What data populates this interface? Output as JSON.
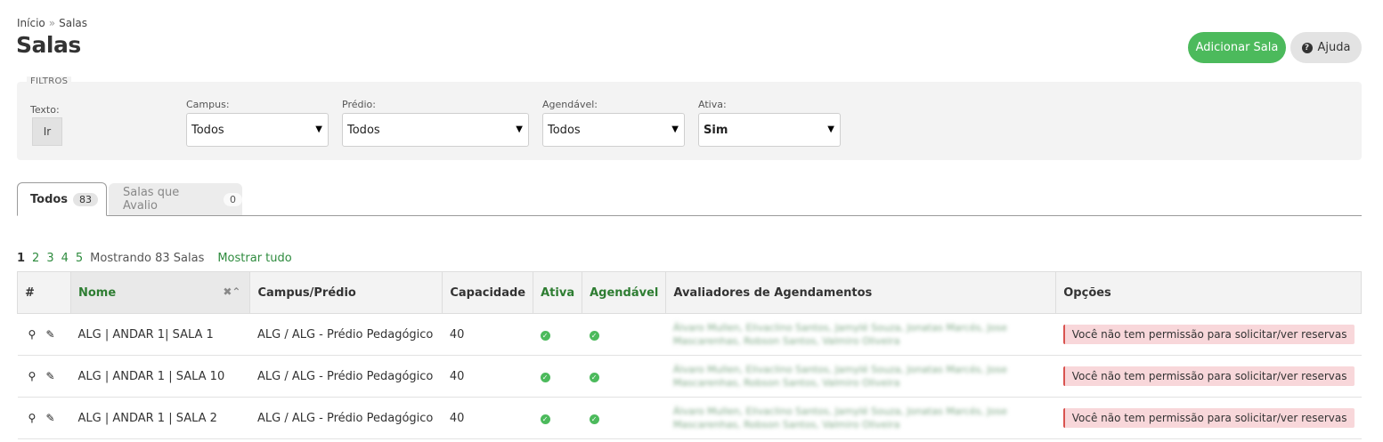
{
  "breadcrumb": {
    "home": "Início",
    "separator": "»",
    "current": "Salas"
  },
  "page_title": "Salas",
  "header_buttons": {
    "add": "Adicionar Sala",
    "help": "Ajuda"
  },
  "filters": {
    "legend": "FILTROS",
    "texto_label": "Texto:",
    "ir_label": "Ir",
    "campus_label": "Campus:",
    "campus_value": "Todos",
    "predio_label": "Prédio:",
    "predio_value": "Todos",
    "agendavel_label": "Agendável:",
    "agendavel_value": "Todos",
    "ativa_label": "Ativa:",
    "ativa_value": "Sim"
  },
  "tabs": [
    {
      "label": "Todos",
      "count": "83"
    },
    {
      "label": "Salas que Avalio",
      "count": "0"
    }
  ],
  "pagination": {
    "current": "1",
    "pages": [
      "2",
      "3",
      "4",
      "5"
    ],
    "info": "Mostrando 83 Salas",
    "show_all": "Mostrar tudo"
  },
  "table": {
    "headers": {
      "hash": "#",
      "nome": "Nome",
      "campus": "Campus/Prédio",
      "capacidade": "Capacidade",
      "ativa": "Ativa",
      "agendavel": "Agendável",
      "avaliadores": "Avaliadores de Agendamentos",
      "opcoes": "Opções"
    },
    "rows": [
      {
        "nome": "ALG | ANDAR 1| SALA 1",
        "campus": "ALG / ALG - Prédio Pedagógico",
        "capacidade": "40",
        "avaliadores": "Álvaro Mullen, Elivaclino Santos, Jamylé Souza, Jonatas Marcés, Jose Mascarenhas, Robson Santos, Valmiro Oliveira",
        "opcoes": "Você não tem permissão para solicitar/ver reservas"
      },
      {
        "nome": "ALG | ANDAR 1 | SALA 10",
        "campus": "ALG / ALG - Prédio Pedagógico",
        "capacidade": "40",
        "avaliadores": "Álvaro Mullen, Elivaclino Santos, Jamylé Souza, Jonatas Marcés, Jose Mascarenhas, Robson Santos, Valmiro Oliveira",
        "opcoes": "Você não tem permissão para solicitar/ver reservas"
      },
      {
        "nome": "ALG | ANDAR 1 | SALA 2",
        "campus": "ALG / ALG - Prédio Pedagógico",
        "capacidade": "40",
        "avaliadores": "Álvaro Mullen, Elivaclino Santos, Jamylé Souza, Jonatas Marcés, Jose Mascarenhas, Robson Santos, Valmiro Oliveira",
        "opcoes": "Você não tem permissão para solicitar/ver reservas"
      }
    ]
  },
  "colors": {
    "primary_green": "#4cba5c",
    "link_green": "#2e8b3e",
    "alert_bg": "#f8d7da",
    "alert_border": "#d9534f"
  },
  "icons": {
    "search": "search-icon",
    "edit": "edit-icon",
    "check": "check-circle-icon",
    "help": "question-circle-icon"
  }
}
